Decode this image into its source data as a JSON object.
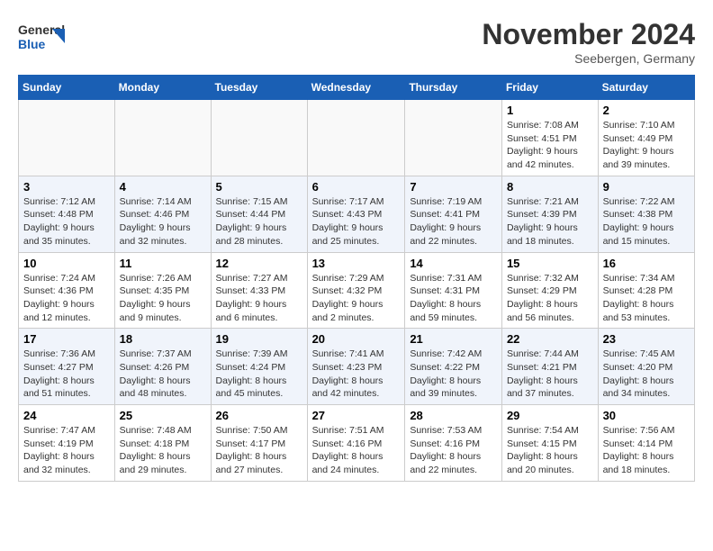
{
  "header": {
    "logo_line1": "General",
    "logo_line2": "Blue",
    "month": "November 2024",
    "location": "Seebergen, Germany"
  },
  "weekdays": [
    "Sunday",
    "Monday",
    "Tuesday",
    "Wednesday",
    "Thursday",
    "Friday",
    "Saturday"
  ],
  "weeks": [
    [
      {
        "day": "",
        "info": ""
      },
      {
        "day": "",
        "info": ""
      },
      {
        "day": "",
        "info": ""
      },
      {
        "day": "",
        "info": ""
      },
      {
        "day": "",
        "info": ""
      },
      {
        "day": "1",
        "info": "Sunrise: 7:08 AM\nSunset: 4:51 PM\nDaylight: 9 hours\nand 42 minutes."
      },
      {
        "day": "2",
        "info": "Sunrise: 7:10 AM\nSunset: 4:49 PM\nDaylight: 9 hours\nand 39 minutes."
      }
    ],
    [
      {
        "day": "3",
        "info": "Sunrise: 7:12 AM\nSunset: 4:48 PM\nDaylight: 9 hours\nand 35 minutes."
      },
      {
        "day": "4",
        "info": "Sunrise: 7:14 AM\nSunset: 4:46 PM\nDaylight: 9 hours\nand 32 minutes."
      },
      {
        "day": "5",
        "info": "Sunrise: 7:15 AM\nSunset: 4:44 PM\nDaylight: 9 hours\nand 28 minutes."
      },
      {
        "day": "6",
        "info": "Sunrise: 7:17 AM\nSunset: 4:43 PM\nDaylight: 9 hours\nand 25 minutes."
      },
      {
        "day": "7",
        "info": "Sunrise: 7:19 AM\nSunset: 4:41 PM\nDaylight: 9 hours\nand 22 minutes."
      },
      {
        "day": "8",
        "info": "Sunrise: 7:21 AM\nSunset: 4:39 PM\nDaylight: 9 hours\nand 18 minutes."
      },
      {
        "day": "9",
        "info": "Sunrise: 7:22 AM\nSunset: 4:38 PM\nDaylight: 9 hours\nand 15 minutes."
      }
    ],
    [
      {
        "day": "10",
        "info": "Sunrise: 7:24 AM\nSunset: 4:36 PM\nDaylight: 9 hours\nand 12 minutes."
      },
      {
        "day": "11",
        "info": "Sunrise: 7:26 AM\nSunset: 4:35 PM\nDaylight: 9 hours\nand 9 minutes."
      },
      {
        "day": "12",
        "info": "Sunrise: 7:27 AM\nSunset: 4:33 PM\nDaylight: 9 hours\nand 6 minutes."
      },
      {
        "day": "13",
        "info": "Sunrise: 7:29 AM\nSunset: 4:32 PM\nDaylight: 9 hours\nand 2 minutes."
      },
      {
        "day": "14",
        "info": "Sunrise: 7:31 AM\nSunset: 4:31 PM\nDaylight: 8 hours\nand 59 minutes."
      },
      {
        "day": "15",
        "info": "Sunrise: 7:32 AM\nSunset: 4:29 PM\nDaylight: 8 hours\nand 56 minutes."
      },
      {
        "day": "16",
        "info": "Sunrise: 7:34 AM\nSunset: 4:28 PM\nDaylight: 8 hours\nand 53 minutes."
      }
    ],
    [
      {
        "day": "17",
        "info": "Sunrise: 7:36 AM\nSunset: 4:27 PM\nDaylight: 8 hours\nand 51 minutes."
      },
      {
        "day": "18",
        "info": "Sunrise: 7:37 AM\nSunset: 4:26 PM\nDaylight: 8 hours\nand 48 minutes."
      },
      {
        "day": "19",
        "info": "Sunrise: 7:39 AM\nSunset: 4:24 PM\nDaylight: 8 hours\nand 45 minutes."
      },
      {
        "day": "20",
        "info": "Sunrise: 7:41 AM\nSunset: 4:23 PM\nDaylight: 8 hours\nand 42 minutes."
      },
      {
        "day": "21",
        "info": "Sunrise: 7:42 AM\nSunset: 4:22 PM\nDaylight: 8 hours\nand 39 minutes."
      },
      {
        "day": "22",
        "info": "Sunrise: 7:44 AM\nSunset: 4:21 PM\nDaylight: 8 hours\nand 37 minutes."
      },
      {
        "day": "23",
        "info": "Sunrise: 7:45 AM\nSunset: 4:20 PM\nDaylight: 8 hours\nand 34 minutes."
      }
    ],
    [
      {
        "day": "24",
        "info": "Sunrise: 7:47 AM\nSunset: 4:19 PM\nDaylight: 8 hours\nand 32 minutes."
      },
      {
        "day": "25",
        "info": "Sunrise: 7:48 AM\nSunset: 4:18 PM\nDaylight: 8 hours\nand 29 minutes."
      },
      {
        "day": "26",
        "info": "Sunrise: 7:50 AM\nSunset: 4:17 PM\nDaylight: 8 hours\nand 27 minutes."
      },
      {
        "day": "27",
        "info": "Sunrise: 7:51 AM\nSunset: 4:16 PM\nDaylight: 8 hours\nand 24 minutes."
      },
      {
        "day": "28",
        "info": "Sunrise: 7:53 AM\nSunset: 4:16 PM\nDaylight: 8 hours\nand 22 minutes."
      },
      {
        "day": "29",
        "info": "Sunrise: 7:54 AM\nSunset: 4:15 PM\nDaylight: 8 hours\nand 20 minutes."
      },
      {
        "day": "30",
        "info": "Sunrise: 7:56 AM\nSunset: 4:14 PM\nDaylight: 8 hours\nand 18 minutes."
      }
    ]
  ]
}
